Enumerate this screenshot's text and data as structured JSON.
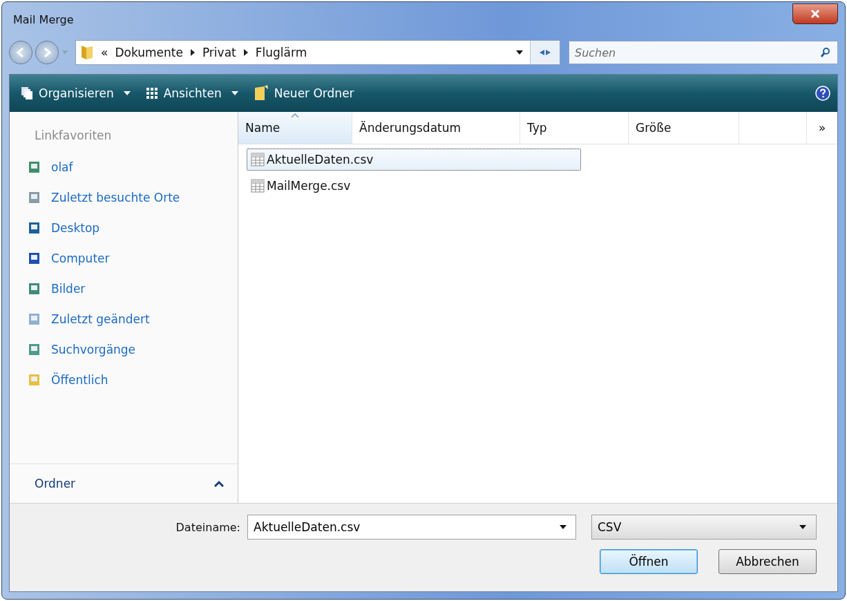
{
  "window": {
    "title": "Mail Merge"
  },
  "address": {
    "prefix": "«",
    "crumbs": [
      "Dokumente",
      "Privat",
      "Fluglärm"
    ]
  },
  "search": {
    "placeholder": "Suchen"
  },
  "toolbar": [
    {
      "label": "Organisieren",
      "dropdown": true
    },
    {
      "label": "Ansichten",
      "dropdown": true
    },
    {
      "label": "Neuer Ordner",
      "dropdown": false
    }
  ],
  "sidebar": {
    "heading": "Linkfavoriten",
    "items": [
      {
        "label": "olaf"
      },
      {
        "label": "Zuletzt besuchte Orte"
      },
      {
        "label": "Desktop"
      },
      {
        "label": "Computer"
      },
      {
        "label": "Bilder"
      },
      {
        "label": "Zuletzt geändert"
      },
      {
        "label": "Suchvorgänge"
      },
      {
        "label": "Öffentlich"
      }
    ],
    "folders": "Ordner"
  },
  "table": {
    "columns": [
      {
        "label": "Name",
        "sorted": true
      },
      {
        "label": "Änderungsdatum",
        "sorted": false
      },
      {
        "label": "Typ",
        "sorted": false
      },
      {
        "label": "Größe",
        "sorted": false
      }
    ],
    "more": "»",
    "rows": [
      {
        "name": "AktuelleDaten.csv",
        "selected": true
      },
      {
        "name": "MailMerge.csv",
        "selected": false
      }
    ]
  },
  "filename": {
    "label": "Dateiname:",
    "value": "AktuelleDaten.csv"
  },
  "filetype": {
    "value": "CSV"
  },
  "buttons": [
    {
      "label": "Öffnen",
      "default": true
    },
    {
      "label": "Abbrechen",
      "default": false
    }
  ]
}
